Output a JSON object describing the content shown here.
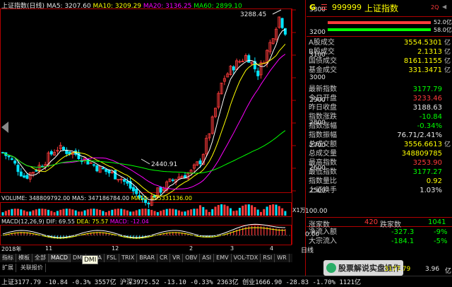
{
  "chart_header": {
    "title": "上证指数(日线)",
    "ma5": "MA5: 3207.60",
    "ma10": "MA10: 3209.29",
    "ma20": "MA20: 3136.25",
    "ma60": "MA60: 2899.10"
  },
  "annotations": {
    "high": "3288.45",
    "low": "2440.91"
  },
  "price_axis": [
    "3300",
    "3200",
    "3100",
    "3000",
    "2900",
    "2800",
    "2700",
    "2600",
    "2500"
  ],
  "volume_header": {
    "volume": "VOLUME: 348809792.00",
    "ma5": "MA5: 347186784.00",
    "ma10": "MA10: 405331136.00"
  },
  "volume_axis_label": "X1万",
  "macd_header": {
    "label": "MACD(12,26,9)",
    "dif": "DIF: 69.55",
    "dea": "DEA: 75.57",
    "macd": "MACD: -12.04"
  },
  "macd_axis": [
    "100.00",
    "0.00"
  ],
  "date_axis": {
    "year": "2018年",
    "months": [
      "11",
      "12",
      "2",
      "3",
      "4"
    ],
    "period": "日线"
  },
  "bottom_tabs": [
    "指标",
    "模板",
    "全部",
    "MACD",
    "DMI",
    "DMA",
    "FSL",
    "TRIX",
    "BRAR",
    "CR",
    "VR",
    "OBV",
    "ASI",
    "EMV",
    "VOL-TDX",
    "RSI",
    "WR"
  ],
  "bottom_tabs2": [
    "扩展",
    "关联报价"
  ],
  "tooltip": "DMI",
  "ticker": "上证3177.79 -10.84 -0.3%  3557亿  沪深3975.52 -13.10 -0.33%  2363亿  创业1666.90 -28.83 -1.70%  1121亿",
  "watermark": "股票解说实盘操作",
  "right_panel": {
    "badge": "G",
    "code": "999999",
    "name": "上证指数",
    "corner": "2Q",
    "bar_label_1": "52.0亿",
    "bar_label_2": "58.0亿",
    "rows1": [
      {
        "label": "A股成交",
        "value": "3554.5301",
        "unit": "亿",
        "color": "#ffff00"
      },
      {
        "label": "B股成交",
        "value": "2.1313",
        "unit": "亿",
        "color": "#ffff00"
      },
      {
        "label": "国债成交",
        "value": "8161.1155",
        "unit": "亿",
        "color": "#ffff00"
      },
      {
        "label": "基金成交",
        "value": "331.3471",
        "unit": "亿",
        "color": "#ffff00"
      }
    ],
    "rows2": [
      {
        "label": "最新指数",
        "value": "3177.79",
        "unit": "",
        "color": "#00ff00"
      },
      {
        "label": "今日开盘",
        "value": "3233.46",
        "unit": "",
        "color": "#ff3b3b"
      },
      {
        "label": "昨日收盘",
        "value": "3188.63",
        "unit": "",
        "color": "#e8e8e8"
      },
      {
        "label": "指数涨跌",
        "value": "-10.84",
        "unit": "",
        "color": "#00ff00"
      },
      {
        "label": "指数涨幅",
        "value": "-0.34%",
        "unit": "",
        "color": "#00ff00"
      },
      {
        "label": "指数振幅",
        "value": "76.71/2.41%",
        "unit": "",
        "color": "#e8e8e8"
      },
      {
        "label": "总成交额",
        "value": "3556.6613",
        "unit": "亿",
        "color": "#ffff00"
      },
      {
        "label": "总成交量",
        "value": "348809785",
        "unit": "",
        "color": "#ffff00"
      },
      {
        "label": "最高指数",
        "value": "3253.90",
        "unit": "",
        "color": "#ff3b3b"
      },
      {
        "label": "最低指数",
        "value": "3177.27",
        "unit": "",
        "color": "#00ff00"
      },
      {
        "label": "指数量比",
        "value": "0.92",
        "unit": "",
        "color": "#ffff00"
      },
      {
        "label": "上证换手",
        "value": "1.03%",
        "unit": "",
        "color": "#e8e8e8"
      }
    ],
    "updown": {
      "up_label": "涨家数",
      "up_value": "420",
      "down_label": "跌家数",
      "down_value": "1041"
    },
    "flows": [
      {
        "label": "净流入额",
        "value": "-327.3",
        "pct": "-9%",
        "color": "#00ff00"
      },
      {
        "label": "大宗流入",
        "value": "-184.1",
        "pct": "-5%",
        "color": "#00ff00"
      }
    ],
    "bottom_row": {
      "tick": "3177.79",
      "small": "3.96",
      "suffix": "亿"
    }
  },
  "colors": {
    "up": "#ff3b3b",
    "down": "#00e5ff",
    "ma5": "#ffffff",
    "ma10": "#ffff00",
    "ma20": "#ff00ff",
    "ma60": "#00ff00",
    "frame": "#b00000"
  }
}
